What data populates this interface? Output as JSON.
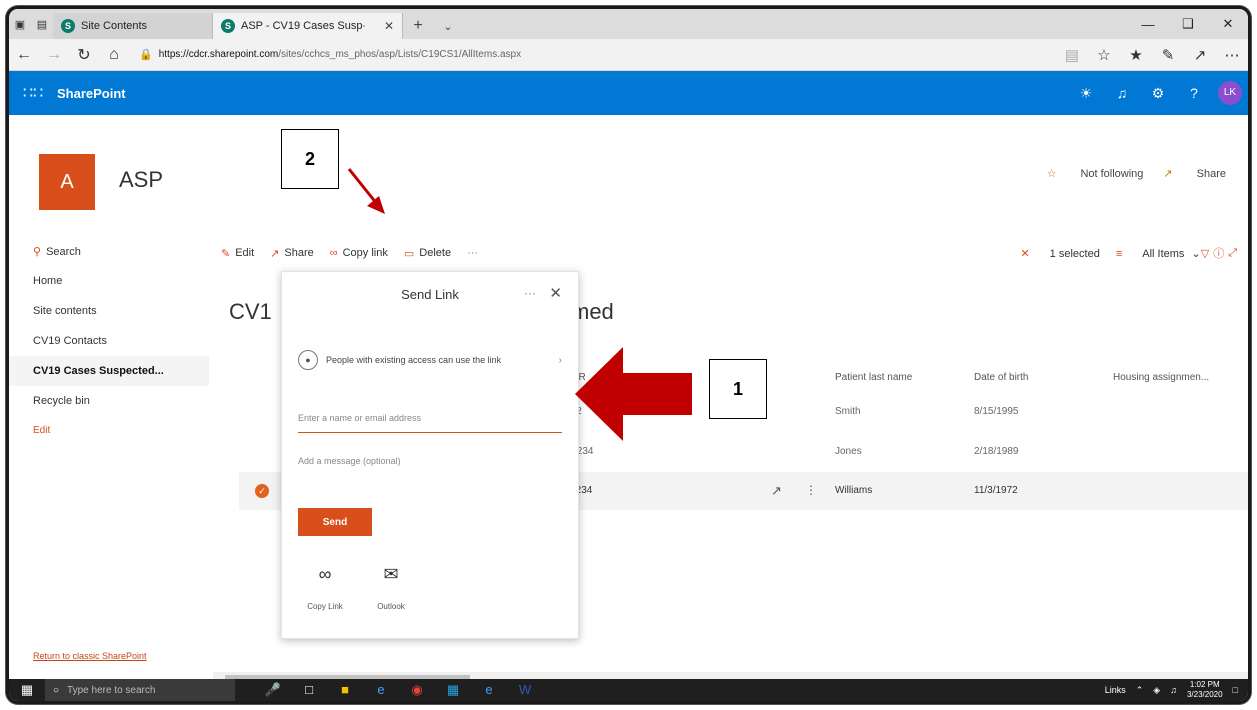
{
  "browser": {
    "tabs": [
      {
        "label": "Site Contents",
        "active": false
      },
      {
        "label": "ASP - CV19 Cases Susp∙",
        "active": true
      }
    ],
    "url_host": "https://cdcr.sharepoint.com",
    "url_path": "/sites/cchcs_ms_phos/asp/Lists/C19CS1/AllItems.aspx"
  },
  "suitebar": {
    "title": "SharePoint",
    "avatar": "LK",
    "brand_color": "#0078d4"
  },
  "site": {
    "logo_letter": "A",
    "name": "ASP",
    "follow_label": "Not following",
    "share_label": "Share"
  },
  "nav": {
    "search_label": "Search",
    "items": [
      "Home",
      "Site contents",
      "CV19 Contacts",
      "CV19 Cases Suspected...",
      "Recycle bin"
    ],
    "edit_label": "Edit",
    "return_label": "Return to classic SharePoint"
  },
  "commands": {
    "edit": "Edit",
    "share": "Share",
    "copy_link": "Copy link",
    "delete": "Delete",
    "more": "···",
    "selected": "1 selected",
    "view": "All Items"
  },
  "list": {
    "title_start": "CV1",
    "title_end": "med",
    "columns": [
      "DCR",
      "Patient last name",
      "Date of birth",
      "Housing assignmen..."
    ],
    "rows": [
      {
        "id": "B12",
        "last": "Smith",
        "dob": "8/15/1995"
      },
      {
        "id": "D1234",
        "last": "Jones",
        "dob": "2/18/1989"
      },
      {
        "id": "F1234",
        "last": "Williams",
        "dob": "11/3/1972"
      }
    ]
  },
  "dialog": {
    "title": "Send Link",
    "more": "···",
    "permission_text": "People with existing access can use the link",
    "recipient_placeholder": "Enter a name or email address",
    "message_placeholder": "Add a message (optional)",
    "send_label": "Send",
    "copy_link_label": "Copy Link",
    "outlook_label": "Outlook"
  },
  "annotations": {
    "box1": "1",
    "box2": "2",
    "arrow_color": "#c00000"
  },
  "taskbar": {
    "search_placeholder": "Type here to search",
    "links_label": "Links",
    "time": "1:02 PM",
    "date": "3/23/2020"
  }
}
